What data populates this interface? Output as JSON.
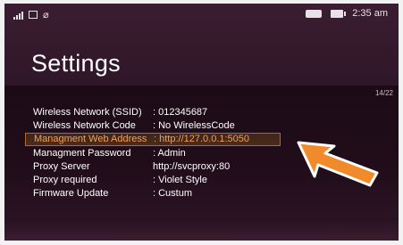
{
  "status_bar": {
    "time": "2:35 am"
  },
  "title": "Settings",
  "pager": "14/22",
  "settings": [
    {
      "label": "Wireless Network (SSID)",
      "value": ": 012345687"
    },
    {
      "label": "Wireless Network Code",
      "value": ": No WirelessCode"
    },
    {
      "label": "Managment Web Address",
      "value": ": http://127.0.0.1:5050"
    },
    {
      "label": "Managment Password",
      "value": ": Admin"
    },
    {
      "label": "Proxy Server",
      "value": "http://svcproxy:80"
    },
    {
      "label": "Proxy required",
      "value": ": Violet Style"
    },
    {
      "label": "Firmware Update",
      "value": ": Custum"
    }
  ],
  "highlight_color": "#f0a05a",
  "arrow_color": "#f08a2a"
}
